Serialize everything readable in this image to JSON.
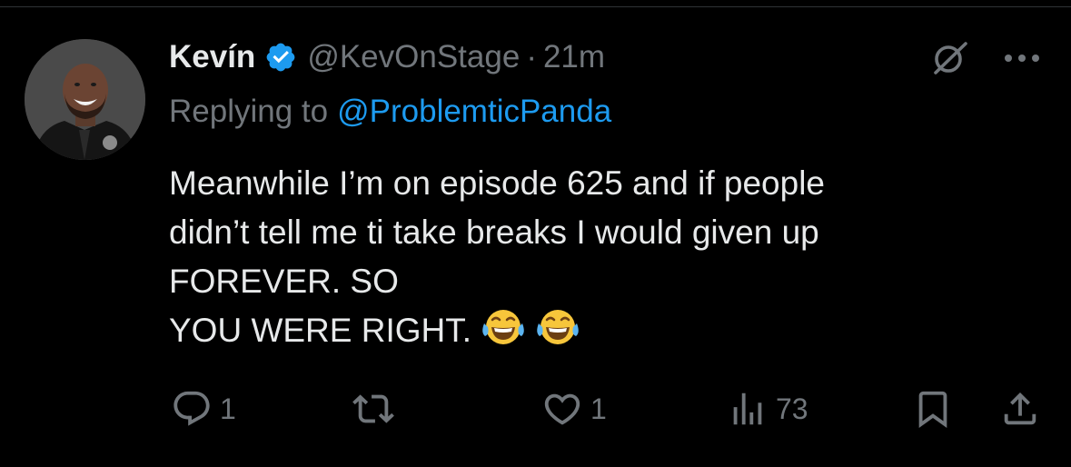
{
  "author": {
    "display_name": "Kevín",
    "handle": "@KevOnStage",
    "time": "21m",
    "separator": "·",
    "verified_color": "#1d9bf0",
    "avatar_icon": "avatar-photo"
  },
  "reply": {
    "prefix": "Replying to",
    "target": "@ProblemticPanda"
  },
  "tweet": {
    "lines": [
      "Meanwhile I’m on episode 625 and if people",
      "didn’t tell me ti take breaks I would given up",
      "FOREVER. SO",
      "YOU WERE RIGHT."
    ],
    "emojis": [
      "tears-of-joy-emoji",
      "tears-of-joy-emoji"
    ]
  },
  "actions": {
    "reply_count": "1",
    "retweet_count": "",
    "like_count": "1",
    "views_count": "73"
  },
  "colors": {
    "background": "#000000",
    "text": "#e7e9ea",
    "secondary": "#71767b",
    "accent": "#1d9bf0"
  }
}
